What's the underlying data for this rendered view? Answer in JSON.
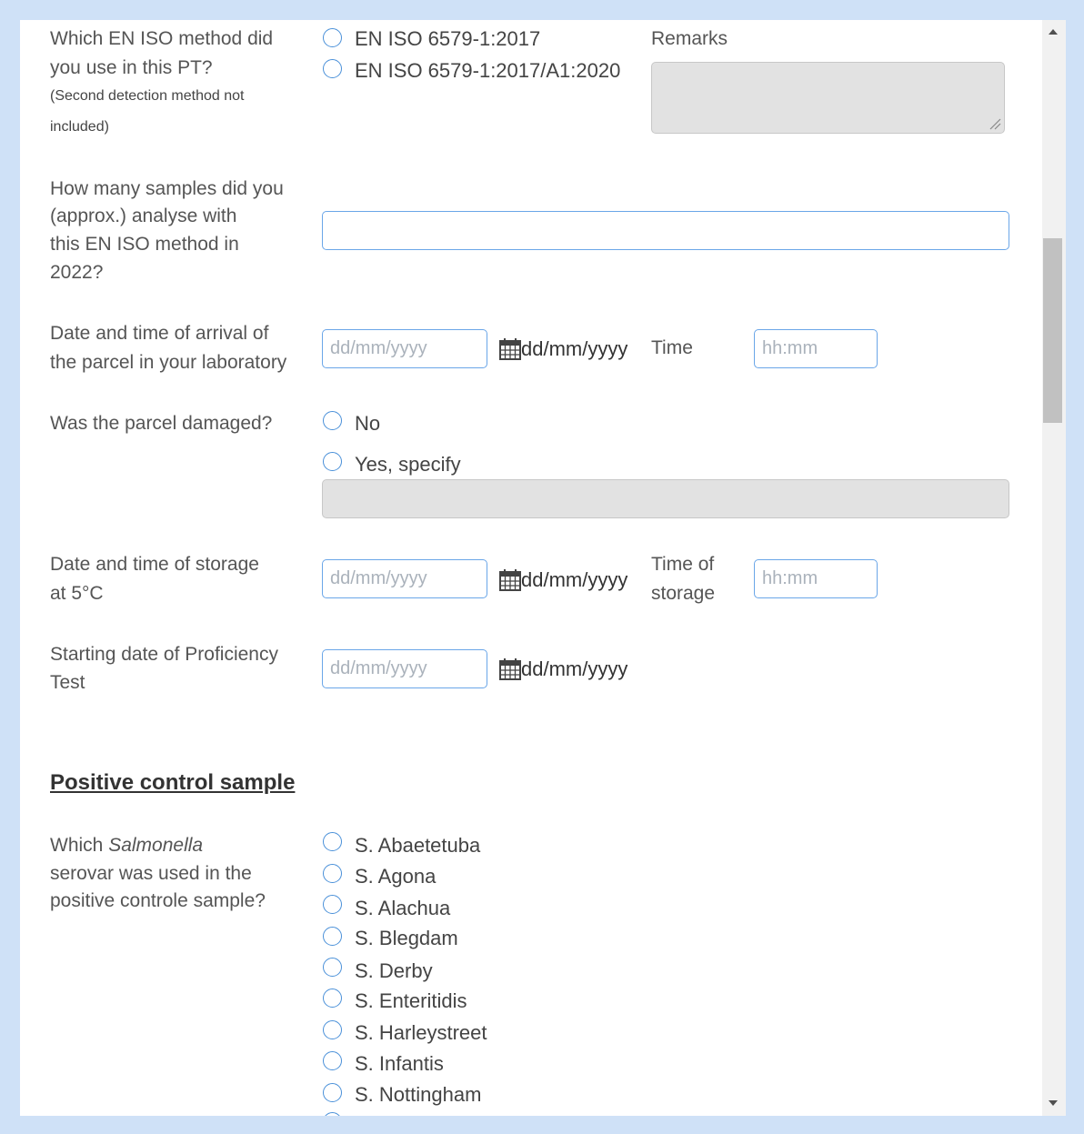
{
  "method": {
    "question_line1": "Which EN ISO method did",
    "question_line2": "you use in this PT?",
    "note_line1": "(Second detection method not",
    "note_line2": "included)",
    "options": [
      "EN ISO 6579-1:2017",
      "EN ISO 6579-1:2017/A1:2020"
    ],
    "remarks_label": "Remarks"
  },
  "samples": {
    "line1": "How many samples did you",
    "line2": "(approx.) analyse with",
    "line3": "this EN ISO method in",
    "line4": "2022?",
    "value": ""
  },
  "arrival": {
    "line1": "Date and time of arrival of",
    "line2": "the parcel in your laboratory",
    "date_placeholder": "dd/mm/yyyy",
    "date_format": "dd/mm/yyyy",
    "time_label": "Time",
    "time_placeholder": "hh:mm"
  },
  "damaged": {
    "question": "Was the parcel damaged?",
    "options": [
      "No",
      "Yes, specify"
    ]
  },
  "storage": {
    "line1": "Date and time of storage",
    "line2": "at 5°C",
    "date_placeholder": "dd/mm/yyyy",
    "date_format": "dd/mm/yyyy",
    "time_label_line1": "Time of",
    "time_label_line2": "storage",
    "time_placeholder": "hh:mm"
  },
  "start": {
    "line1": "Starting date of Proficiency",
    "line2": "Test",
    "date_placeholder": "dd/mm/yyyy",
    "date_format": "dd/mm/yyyy"
  },
  "positive_control": {
    "heading": "Positive control sample",
    "q_prefix": "Which ",
    "q_italic": "Salmonella",
    "q_line2": "serovar was used in the",
    "q_line3": "positive controle sample?",
    "serovars": [
      "S. Abaetetuba",
      "S. Agona",
      "S. Alachua",
      "S. Blegdam",
      "S. Derby",
      "S. Enteritidis",
      "S. Harleystreet",
      "S. Infantis",
      "S. Nottingham"
    ]
  },
  "colors": {
    "page_background": "#cfe1f7",
    "accent_blue": "#4a90d9",
    "disabled_gray": "#e2e2e2"
  }
}
